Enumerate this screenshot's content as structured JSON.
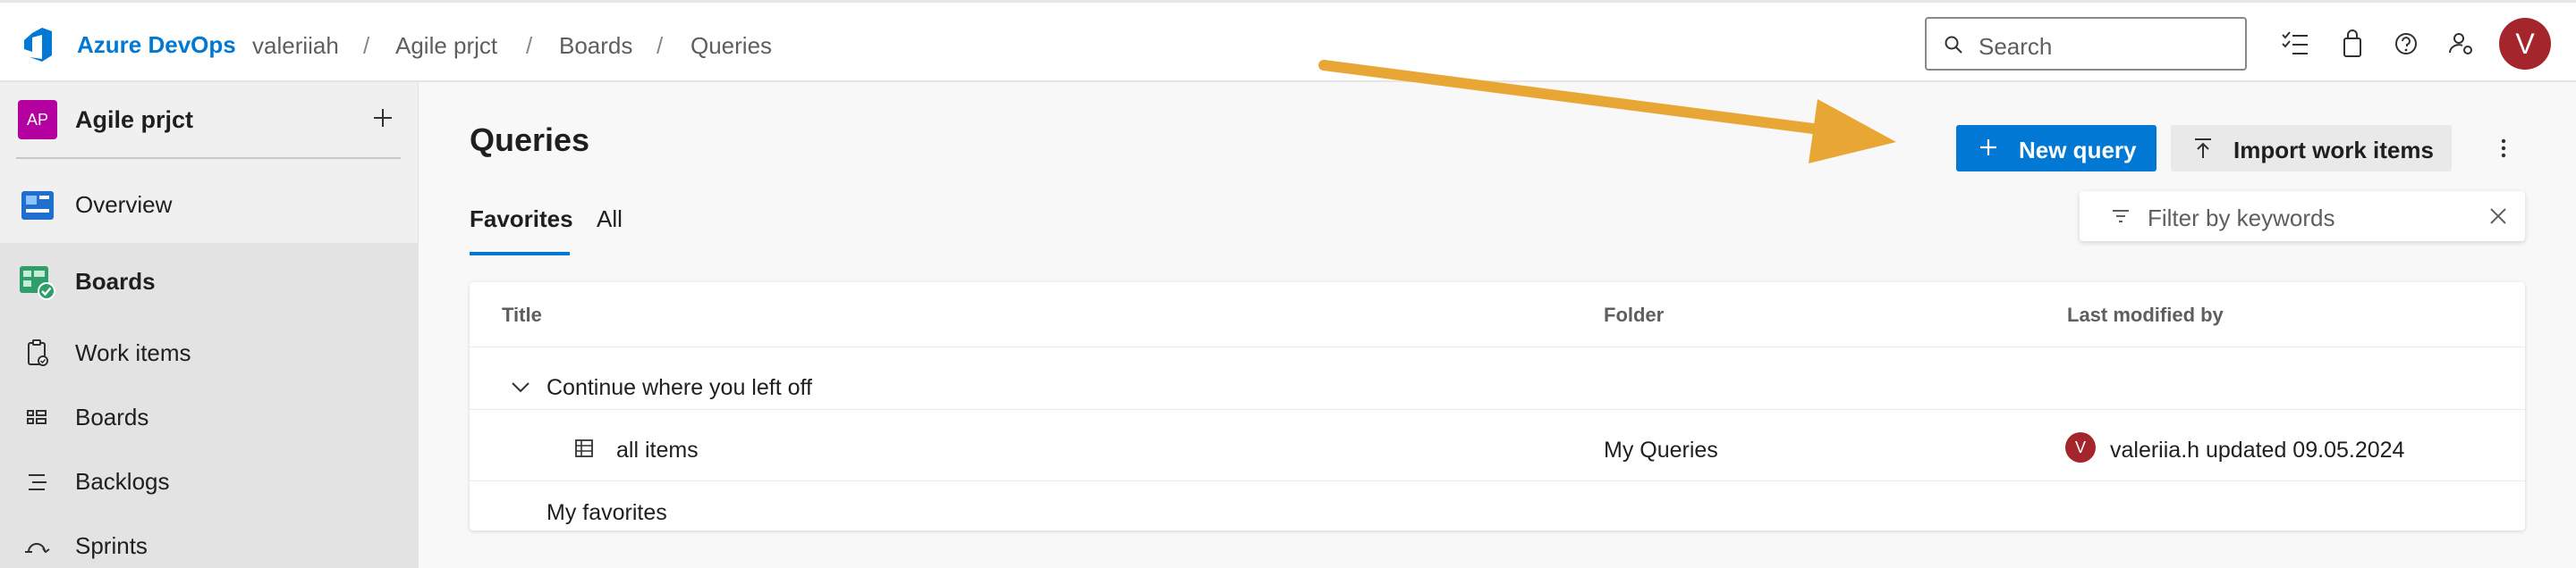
{
  "header": {
    "brand": "Azure DevOps",
    "breadcrumbs": [
      "valeriiah",
      "Agile prjct",
      "Boards",
      "Queries"
    ],
    "search_placeholder": "Search",
    "avatar_initial": "V",
    "icons": [
      "task-list-icon",
      "shopping-bag-icon",
      "help-icon",
      "user-settings-icon"
    ]
  },
  "sidebar": {
    "project_initials": "AP",
    "project_name": "Agile prjct",
    "items": [
      {
        "label": "Overview",
        "icon": "overview-icon"
      },
      {
        "label": "Boards",
        "icon": "boards-hub-icon",
        "active": true
      },
      {
        "label": "Work items",
        "icon": "work-items-icon"
      },
      {
        "label": "Boards",
        "icon": "boards-icon"
      },
      {
        "label": "Backlogs",
        "icon": "backlogs-icon"
      },
      {
        "label": "Sprints",
        "icon": "sprints-icon"
      }
    ]
  },
  "main": {
    "title": "Queries",
    "tabs": [
      {
        "label": "Favorites",
        "active": true
      },
      {
        "label": "All",
        "active": false
      }
    ],
    "new_query_label": "New query",
    "import_label": "Import work items",
    "filter_placeholder": "Filter by keywords",
    "table": {
      "columns": [
        "Title",
        "Folder",
        "Last modified by"
      ],
      "group_label": "Continue where you left off",
      "rows": [
        {
          "title": "all items",
          "folder": "My Queries",
          "modified_initial": "V",
          "modified": "valeriia.h updated 09.05.2024"
        }
      ],
      "favorites_label": "My favorites"
    }
  },
  "colors": {
    "accent": "#0078d4",
    "avatar": "#a4262c",
    "project_badge": "#b4009e",
    "annotation_arrow": "#e8a735"
  }
}
